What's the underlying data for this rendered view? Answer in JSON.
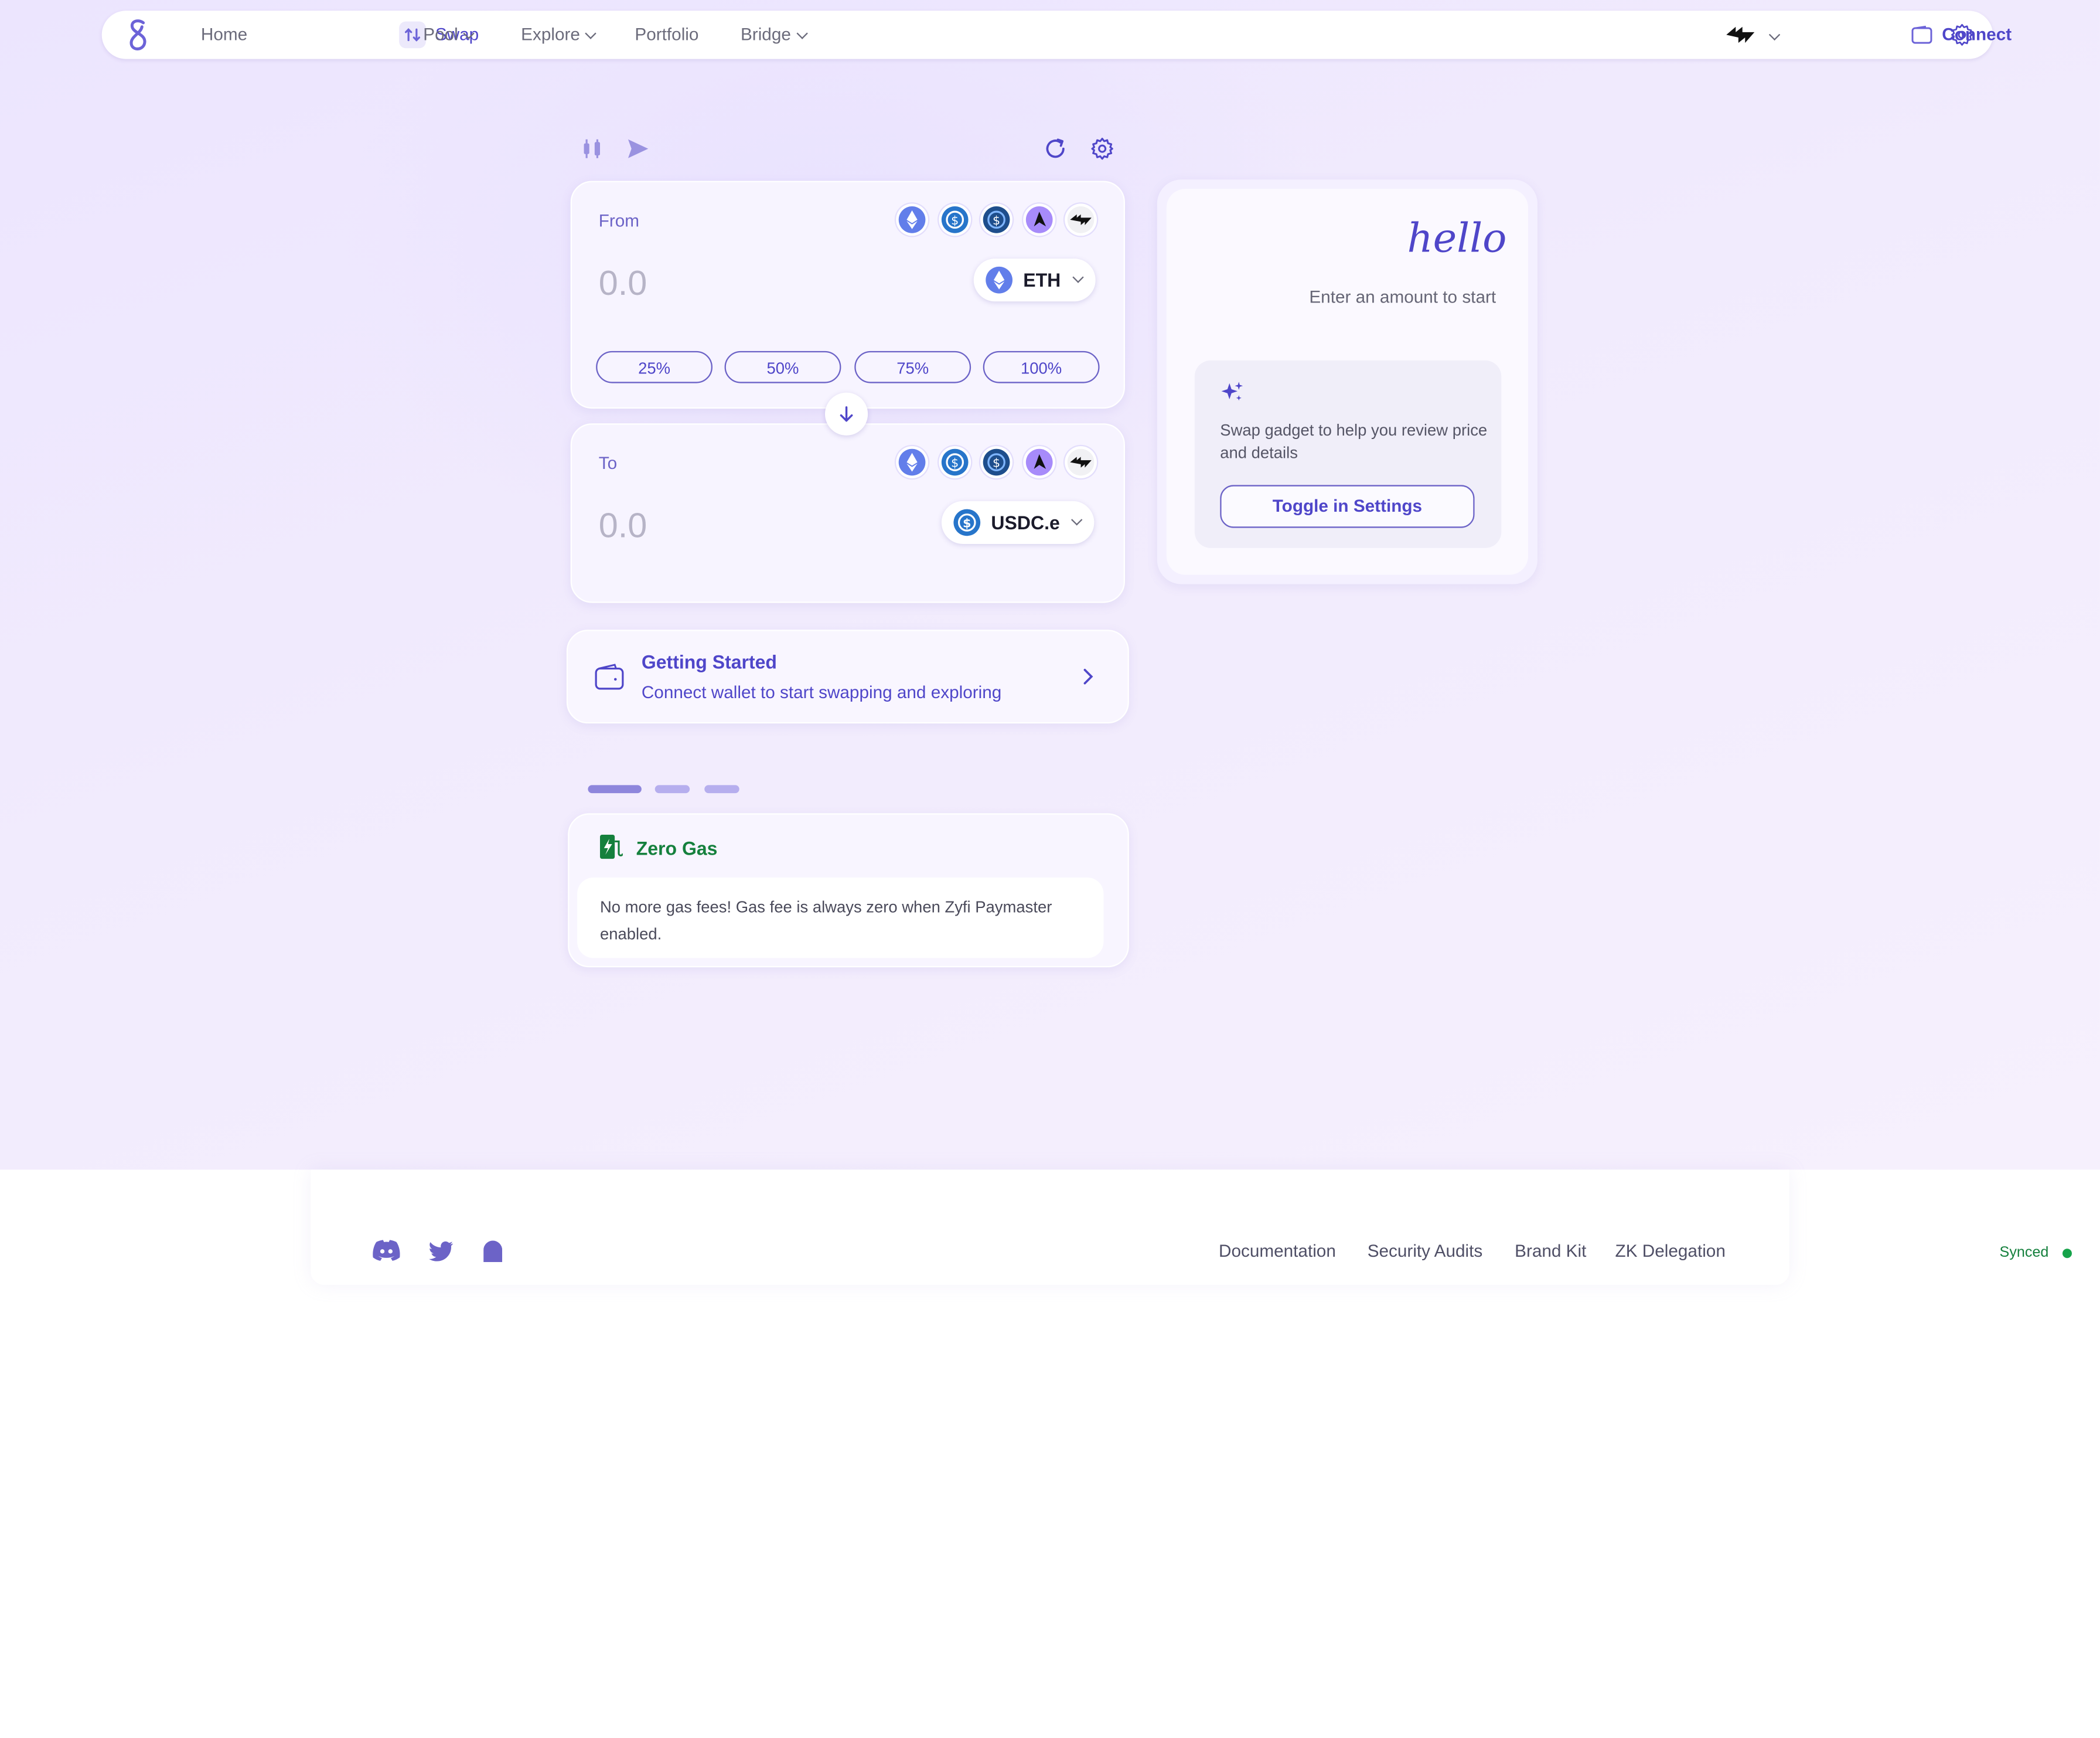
{
  "nav": {
    "items": [
      {
        "label": "Home"
      },
      {
        "label": "Swap"
      },
      {
        "label": "Pool"
      },
      {
        "label": "Explore"
      },
      {
        "label": "Portfolio"
      },
      {
        "label": "Bridge"
      }
    ],
    "connect_label": "Connect"
  },
  "swap": {
    "from_label": "From",
    "from_amount": "0.0",
    "from_token": "ETH",
    "to_label": "To",
    "to_amount": "0.0",
    "to_token": "USDC.e",
    "percent_buttons": [
      "25%",
      "50%",
      "75%",
      "100%"
    ]
  },
  "getting_started": {
    "title": "Getting Started",
    "subtitle": "Connect wallet to start swapping and exploring"
  },
  "promo": {
    "title": "Zero Gas",
    "body": "No more gas fees! Gas fee is always zero when Zyfi Paymaster enabled.",
    "active_slide": 1
  },
  "gadget": {
    "greeting": "hello",
    "hint": "Enter an amount to start",
    "description": "Swap gadget to help you review price and details",
    "toggle_label": "Toggle in Settings"
  },
  "footer": {
    "links": [
      "Documentation",
      "Security Audits",
      "Brand Kit",
      "ZK Delegation"
    ],
    "status": "Synced"
  },
  "colors": {
    "accent": "#4f46c9",
    "eth": "#627eea",
    "usdc": "#2775ca",
    "success": "#15803d"
  }
}
